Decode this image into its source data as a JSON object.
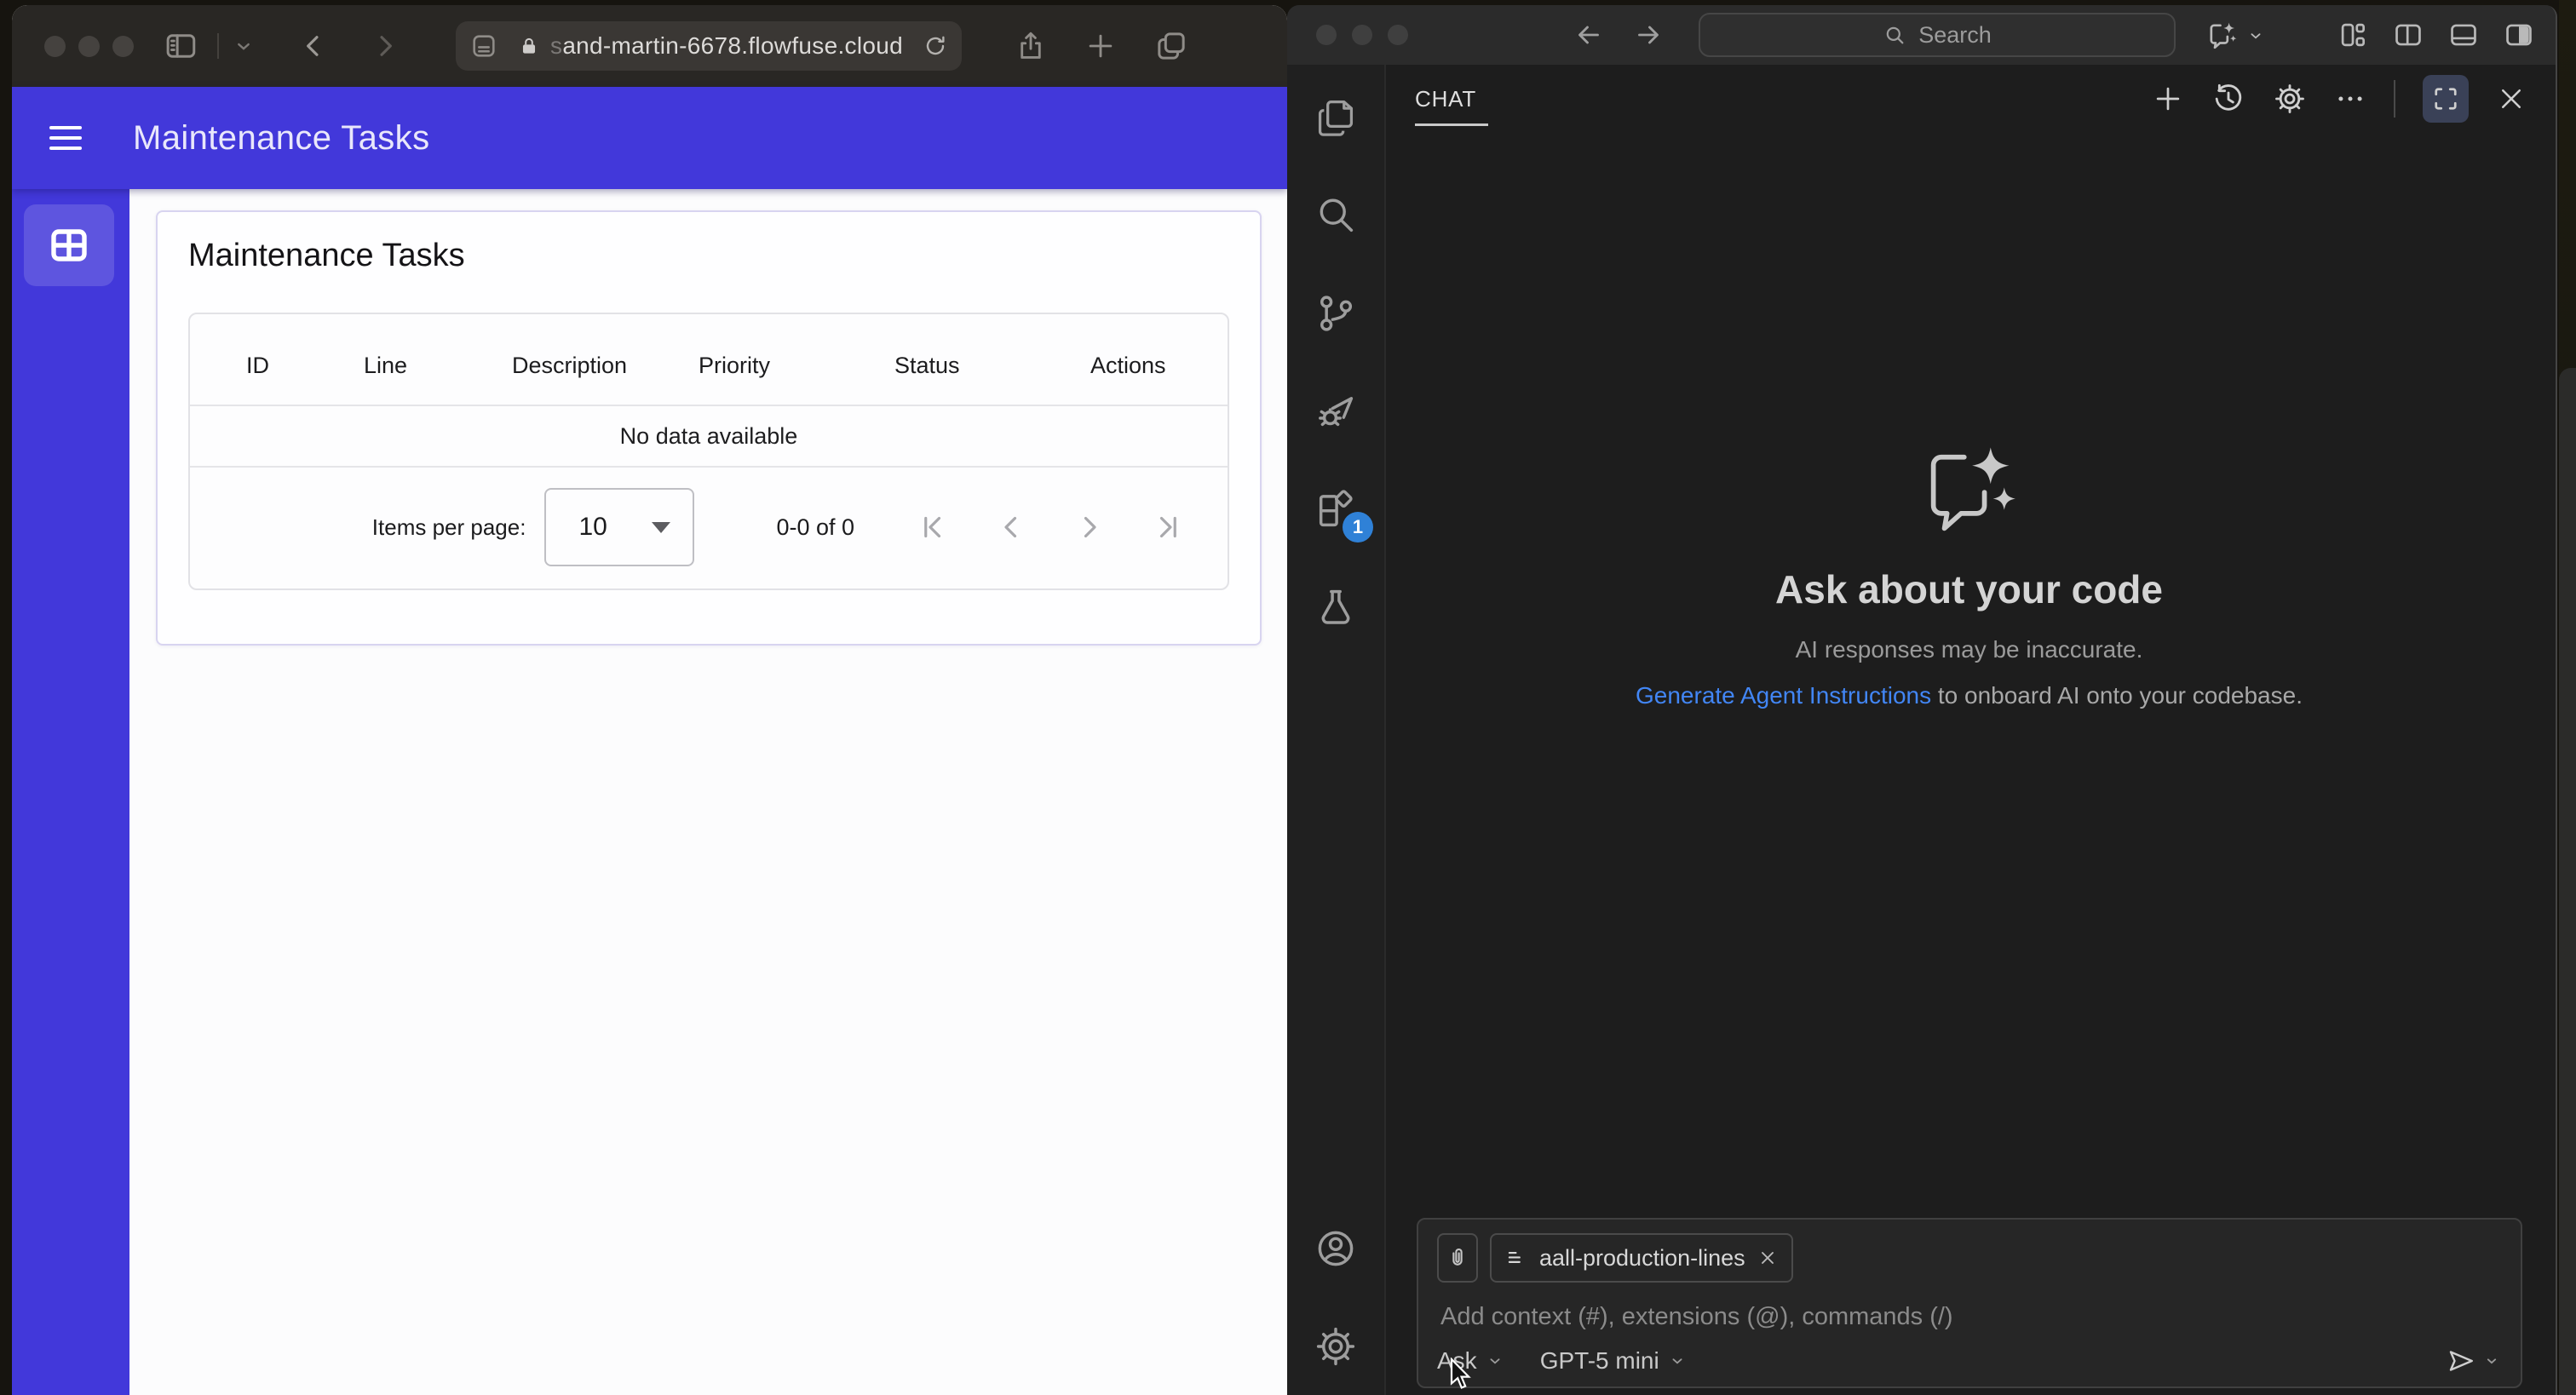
{
  "browser": {
    "url_prefix": "s",
    "url": "and-martin-6678.flowfuse.cloud",
    "app": {
      "title": "Maintenance Tasks",
      "card_title": "Maintenance Tasks",
      "primary_color": "#4238da",
      "table": {
        "columns": [
          "ID",
          "Line",
          "Description",
          "Priority",
          "Status",
          "Actions"
        ],
        "empty_text": "No data available"
      },
      "pagination": {
        "items_per_page_label": "Items per page:",
        "items_per_page_value": "10",
        "range_text": "0-0 of 0"
      }
    }
  },
  "vscode": {
    "search_placeholder": "Search",
    "extensions_badge": "1",
    "chat": {
      "tab": "CHAT",
      "empty_title": "Ask about your code",
      "empty_subtitle": "AI responses may be inaccurate.",
      "link_text": "Generate Agent Instructions",
      "link_suffix": " to onboard AI onto your codebase.",
      "context_chip": "aall-production-lines",
      "input_placeholder": "Add context (#), extensions (@), commands (/)",
      "mode": "Ask",
      "model": "GPT-5 mini"
    },
    "colors": {
      "link": "#4286f5",
      "badge": "#2f81d7",
      "primary": "#4238da"
    }
  }
}
